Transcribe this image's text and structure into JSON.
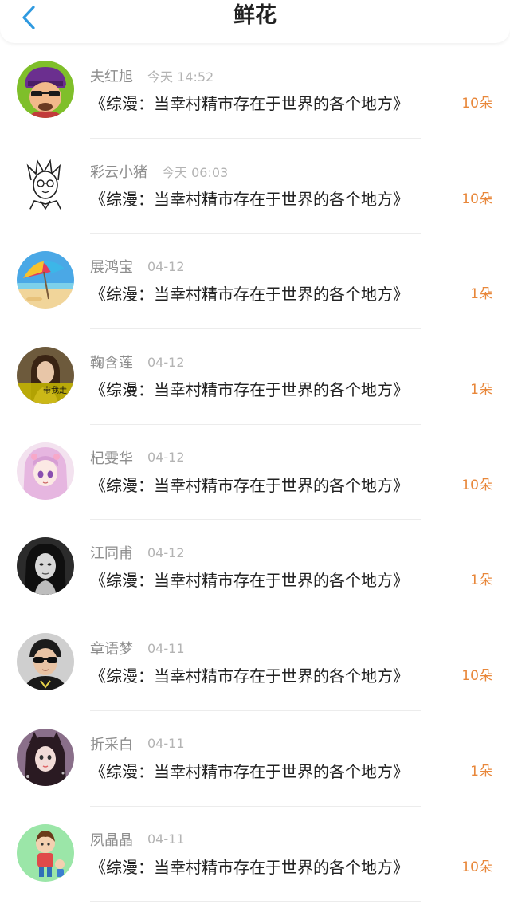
{
  "header": {
    "title": "鲜花",
    "back_icon": "chevron-left-icon",
    "accent_color": "#2f9ae0"
  },
  "flower_color": "#e8873a",
  "rows": [
    {
      "name": "夫红旭",
      "time": "今天 14:52",
      "book": "《综漫：当幸村精市存在于世界的各个地方》",
      "count": "10朵",
      "avatar_icon": "cartoon-man-avatar"
    },
    {
      "name": "彩云小猪",
      "time": "今天 06:03",
      "book": "《综漫：当幸村精市存在于世界的各个地方》",
      "count": "10朵",
      "avatar_icon": "sketch-boy-avatar"
    },
    {
      "name": "展鸿宝",
      "time": "04-12",
      "book": "《综漫：当幸村精市存在于世界的各个地方》",
      "count": "1朵",
      "avatar_icon": "beach-umbrella-avatar"
    },
    {
      "name": "鞠含莲",
      "time": "04-12",
      "book": "《综漫：当幸村精市存在于世界的各个地方》",
      "count": "1朵",
      "avatar_icon": "girl-photo-avatar",
      "avatar_caption": "带我走"
    },
    {
      "name": "杞雯华",
      "time": "04-12",
      "book": "《综漫：当幸村精市存在于世界的各个地方》",
      "count": "10朵",
      "avatar_icon": "anime-girl-avatar"
    },
    {
      "name": "江同甫",
      "time": "04-12",
      "book": "《综漫：当幸村精市存在于世界的各个地方》",
      "count": "1朵",
      "avatar_icon": "bw-portrait-avatar"
    },
    {
      "name": "章语梦",
      "time": "04-11",
      "book": "《综漫：当幸村精市存在于世界的各个地方》",
      "count": "10朵",
      "avatar_icon": "sunglasses-man-avatar"
    },
    {
      "name": "折采白",
      "time": "04-11",
      "book": "《综漫：当幸村精市存在于世界的各个地方》",
      "count": "1朵",
      "avatar_icon": "cat-ears-girl-avatar"
    },
    {
      "name": "夙晶晶",
      "time": "04-11",
      "book": "《综漫：当幸村精市存在于世界的各个地方》",
      "count": "10朵",
      "avatar_icon": "cartoon-couple-avatar"
    }
  ]
}
